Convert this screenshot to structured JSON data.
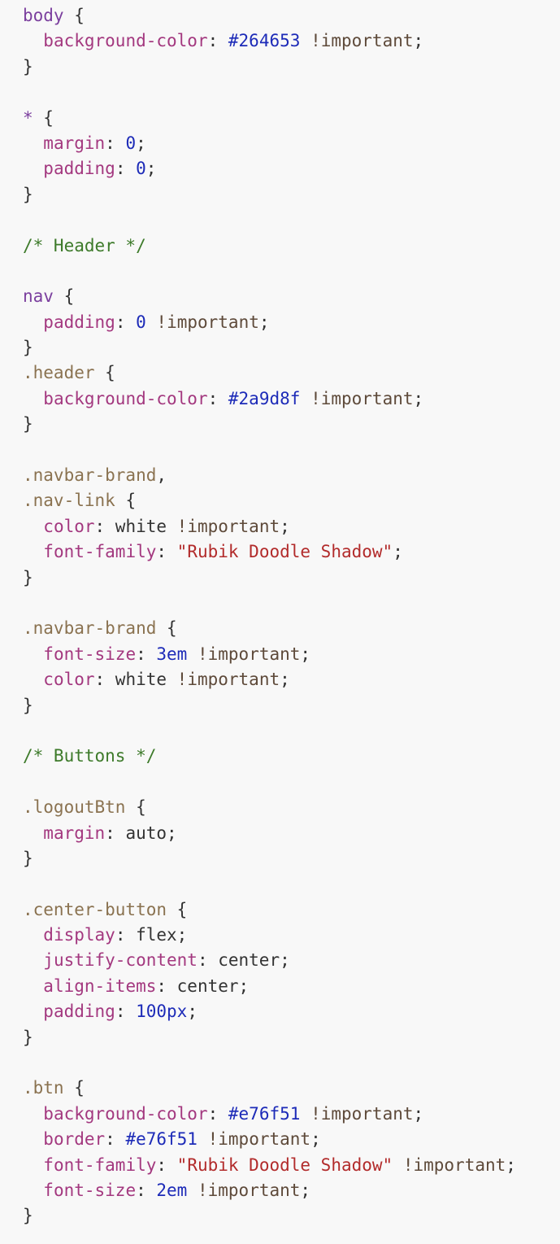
{
  "colors": {
    "selector": "#7b3f9e",
    "class_selector": "#8a7250",
    "property": "#a3387f",
    "number": "#1d2bb8",
    "string": "#b22b2b",
    "comment": "#3d7a2a",
    "punctuation": "#333333",
    "keyword": "#5e4a3a",
    "background": "#f8f8f8"
  },
  "lines": [
    [
      {
        "c": "t-sel",
        "t": "body"
      },
      {
        "c": "t-pun",
        "t": " {"
      }
    ],
    [
      {
        "c": "t-pun",
        "t": "  "
      },
      {
        "c": "t-prop",
        "t": "background-color"
      },
      {
        "c": "t-pun",
        "t": ": "
      },
      {
        "c": "t-num",
        "t": "#264653"
      },
      {
        "c": "t-pun",
        "t": " "
      },
      {
        "c": "t-kw",
        "t": "!important"
      },
      {
        "c": "t-pun",
        "t": ";"
      }
    ],
    [
      {
        "c": "t-pun",
        "t": "}"
      }
    ],
    [],
    [
      {
        "c": "t-sel",
        "t": "*"
      },
      {
        "c": "t-pun",
        "t": " {"
      }
    ],
    [
      {
        "c": "t-pun",
        "t": "  "
      },
      {
        "c": "t-prop",
        "t": "margin"
      },
      {
        "c": "t-pun",
        "t": ": "
      },
      {
        "c": "t-num",
        "t": "0"
      },
      {
        "c": "t-pun",
        "t": ";"
      }
    ],
    [
      {
        "c": "t-pun",
        "t": "  "
      },
      {
        "c": "t-prop",
        "t": "padding"
      },
      {
        "c": "t-pun",
        "t": ": "
      },
      {
        "c": "t-num",
        "t": "0"
      },
      {
        "c": "t-pun",
        "t": ";"
      }
    ],
    [
      {
        "c": "t-pun",
        "t": "}"
      }
    ],
    [],
    [
      {
        "c": "t-com",
        "t": "/* Header */"
      }
    ],
    [],
    [
      {
        "c": "t-sel",
        "t": "nav"
      },
      {
        "c": "t-pun",
        "t": " {"
      }
    ],
    [
      {
        "c": "t-pun",
        "t": "  "
      },
      {
        "c": "t-prop",
        "t": "padding"
      },
      {
        "c": "t-pun",
        "t": ": "
      },
      {
        "c": "t-num",
        "t": "0"
      },
      {
        "c": "t-pun",
        "t": " "
      },
      {
        "c": "t-kw",
        "t": "!important"
      },
      {
        "c": "t-pun",
        "t": ";"
      }
    ],
    [
      {
        "c": "t-pun",
        "t": "}"
      }
    ],
    [
      {
        "c": "t-cls",
        "t": ".header"
      },
      {
        "c": "t-pun",
        "t": " {"
      }
    ],
    [
      {
        "c": "t-pun",
        "t": "  "
      },
      {
        "c": "t-prop",
        "t": "background-color"
      },
      {
        "c": "t-pun",
        "t": ": "
      },
      {
        "c": "t-num",
        "t": "#2a9d8f"
      },
      {
        "c": "t-pun",
        "t": " "
      },
      {
        "c": "t-kw",
        "t": "!important"
      },
      {
        "c": "t-pun",
        "t": ";"
      }
    ],
    [
      {
        "c": "t-pun",
        "t": "}"
      }
    ],
    [],
    [
      {
        "c": "t-cls",
        "t": ".navbar-brand"
      },
      {
        "c": "t-pun",
        "t": ","
      }
    ],
    [
      {
        "c": "t-cls",
        "t": ".nav-link"
      },
      {
        "c": "t-pun",
        "t": " {"
      }
    ],
    [
      {
        "c": "t-pun",
        "t": "  "
      },
      {
        "c": "t-prop",
        "t": "color"
      },
      {
        "c": "t-pun",
        "t": ": white "
      },
      {
        "c": "t-kw",
        "t": "!important"
      },
      {
        "c": "t-pun",
        "t": ";"
      }
    ],
    [
      {
        "c": "t-pun",
        "t": "  "
      },
      {
        "c": "t-prop",
        "t": "font-family"
      },
      {
        "c": "t-pun",
        "t": ": "
      },
      {
        "c": "t-str",
        "t": "\"Rubik Doodle Shadow\""
      },
      {
        "c": "t-pun",
        "t": ";"
      }
    ],
    [
      {
        "c": "t-pun",
        "t": "}"
      }
    ],
    [],
    [
      {
        "c": "t-cls",
        "t": ".navbar-brand"
      },
      {
        "c": "t-pun",
        "t": " {"
      }
    ],
    [
      {
        "c": "t-pun",
        "t": "  "
      },
      {
        "c": "t-prop",
        "t": "font-size"
      },
      {
        "c": "t-pun",
        "t": ": "
      },
      {
        "c": "t-num",
        "t": "3em"
      },
      {
        "c": "t-pun",
        "t": " "
      },
      {
        "c": "t-kw",
        "t": "!important"
      },
      {
        "c": "t-pun",
        "t": ";"
      }
    ],
    [
      {
        "c": "t-pun",
        "t": "  "
      },
      {
        "c": "t-prop",
        "t": "color"
      },
      {
        "c": "t-pun",
        "t": ": white "
      },
      {
        "c": "t-kw",
        "t": "!important"
      },
      {
        "c": "t-pun",
        "t": ";"
      }
    ],
    [
      {
        "c": "t-pun",
        "t": "}"
      }
    ],
    [],
    [
      {
        "c": "t-com",
        "t": "/* Buttons */"
      }
    ],
    [],
    [
      {
        "c": "t-cls",
        "t": ".logoutBtn"
      },
      {
        "c": "t-pun",
        "t": " {"
      }
    ],
    [
      {
        "c": "t-pun",
        "t": "  "
      },
      {
        "c": "t-prop",
        "t": "margin"
      },
      {
        "c": "t-pun",
        "t": ": auto;"
      }
    ],
    [
      {
        "c": "t-pun",
        "t": "}"
      }
    ],
    [],
    [
      {
        "c": "t-cls",
        "t": ".center-button"
      },
      {
        "c": "t-pun",
        "t": " {"
      }
    ],
    [
      {
        "c": "t-pun",
        "t": "  "
      },
      {
        "c": "t-prop",
        "t": "display"
      },
      {
        "c": "t-pun",
        "t": ": flex;"
      }
    ],
    [
      {
        "c": "t-pun",
        "t": "  "
      },
      {
        "c": "t-prop",
        "t": "justify-content"
      },
      {
        "c": "t-pun",
        "t": ": center;"
      }
    ],
    [
      {
        "c": "t-pun",
        "t": "  "
      },
      {
        "c": "t-prop",
        "t": "align-items"
      },
      {
        "c": "t-pun",
        "t": ": center;"
      }
    ],
    [
      {
        "c": "t-pun",
        "t": "  "
      },
      {
        "c": "t-prop",
        "t": "padding"
      },
      {
        "c": "t-pun",
        "t": ": "
      },
      {
        "c": "t-num",
        "t": "100px"
      },
      {
        "c": "t-pun",
        "t": ";"
      }
    ],
    [
      {
        "c": "t-pun",
        "t": "}"
      }
    ],
    [],
    [
      {
        "c": "t-cls",
        "t": ".btn"
      },
      {
        "c": "t-pun",
        "t": " {"
      }
    ],
    [
      {
        "c": "t-pun",
        "t": "  "
      },
      {
        "c": "t-prop",
        "t": "background-color"
      },
      {
        "c": "t-pun",
        "t": ": "
      },
      {
        "c": "t-num",
        "t": "#e76f51"
      },
      {
        "c": "t-pun",
        "t": " "
      },
      {
        "c": "t-kw",
        "t": "!important"
      },
      {
        "c": "t-pun",
        "t": ";"
      }
    ],
    [
      {
        "c": "t-pun",
        "t": "  "
      },
      {
        "c": "t-prop",
        "t": "border"
      },
      {
        "c": "t-pun",
        "t": ": "
      },
      {
        "c": "t-num",
        "t": "#e76f51"
      },
      {
        "c": "t-pun",
        "t": " "
      },
      {
        "c": "t-kw",
        "t": "!important"
      },
      {
        "c": "t-pun",
        "t": ";"
      }
    ],
    [
      {
        "c": "t-pun",
        "t": "  "
      },
      {
        "c": "t-prop",
        "t": "font-family"
      },
      {
        "c": "t-pun",
        "t": ": "
      },
      {
        "c": "t-str",
        "t": "\"Rubik Doodle Shadow\""
      },
      {
        "c": "t-pun",
        "t": " "
      },
      {
        "c": "t-kw",
        "t": "!important"
      },
      {
        "c": "t-pun",
        "t": ";"
      }
    ],
    [
      {
        "c": "t-pun",
        "t": "  "
      },
      {
        "c": "t-prop",
        "t": "font-size"
      },
      {
        "c": "t-pun",
        "t": ": "
      },
      {
        "c": "t-num",
        "t": "2em"
      },
      {
        "c": "t-pun",
        "t": " "
      },
      {
        "c": "t-kw",
        "t": "!important"
      },
      {
        "c": "t-pun",
        "t": ";"
      }
    ],
    [
      {
        "c": "t-pun",
        "t": "}"
      }
    ]
  ]
}
